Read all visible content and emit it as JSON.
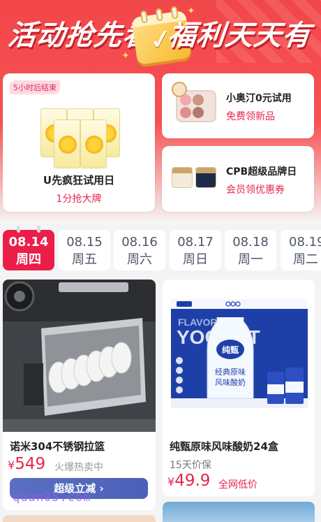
{
  "hero": {
    "title_left": "活动抢先看",
    "title_right": "福利天天有"
  },
  "promo_big": {
    "badge": "5小时后结束",
    "title": "U先疯狂试用日",
    "subtitle": "1分抢大牌"
  },
  "promo_small": [
    {
      "title": "小奥汀0元试用",
      "subtitle": "免费领新品"
    },
    {
      "title": "CPB超级品牌日",
      "subtitle": "会员领优惠券"
    }
  ],
  "dates": [
    {
      "date": "08.14",
      "weekday": "周四",
      "active": true
    },
    {
      "date": "08.15",
      "weekday": "周五"
    },
    {
      "date": "08.16",
      "weekday": "周六"
    },
    {
      "date": "08.17",
      "weekday": "周日"
    },
    {
      "date": "08.18",
      "weekday": "周一"
    },
    {
      "date": "08.19",
      "weekday": "周二"
    }
  ],
  "products": [
    {
      "name": "诺米304不锈钢拉篮",
      "currency": "¥",
      "price": "549",
      "note": "火爆热卖中",
      "button": "超级立减",
      "button_icon": "chevron-right-icon"
    },
    {
      "name": "纯甄原味风味酸奶24盒",
      "sub": "15天价保",
      "currency": "¥",
      "price": "49.9",
      "tag": "全网低价",
      "image_text": {
        "brand": "纯甄",
        "banner": "FLAVORED YOGURT",
        "product_line1": "经典原味",
        "product_line2": "风味酸奶"
      }
    }
  ],
  "watermark": "quan05.com",
  "colors": {
    "accent_red": "#eb1e4a",
    "banner_red": "#f2474a",
    "button_blue": "#5266bd"
  }
}
